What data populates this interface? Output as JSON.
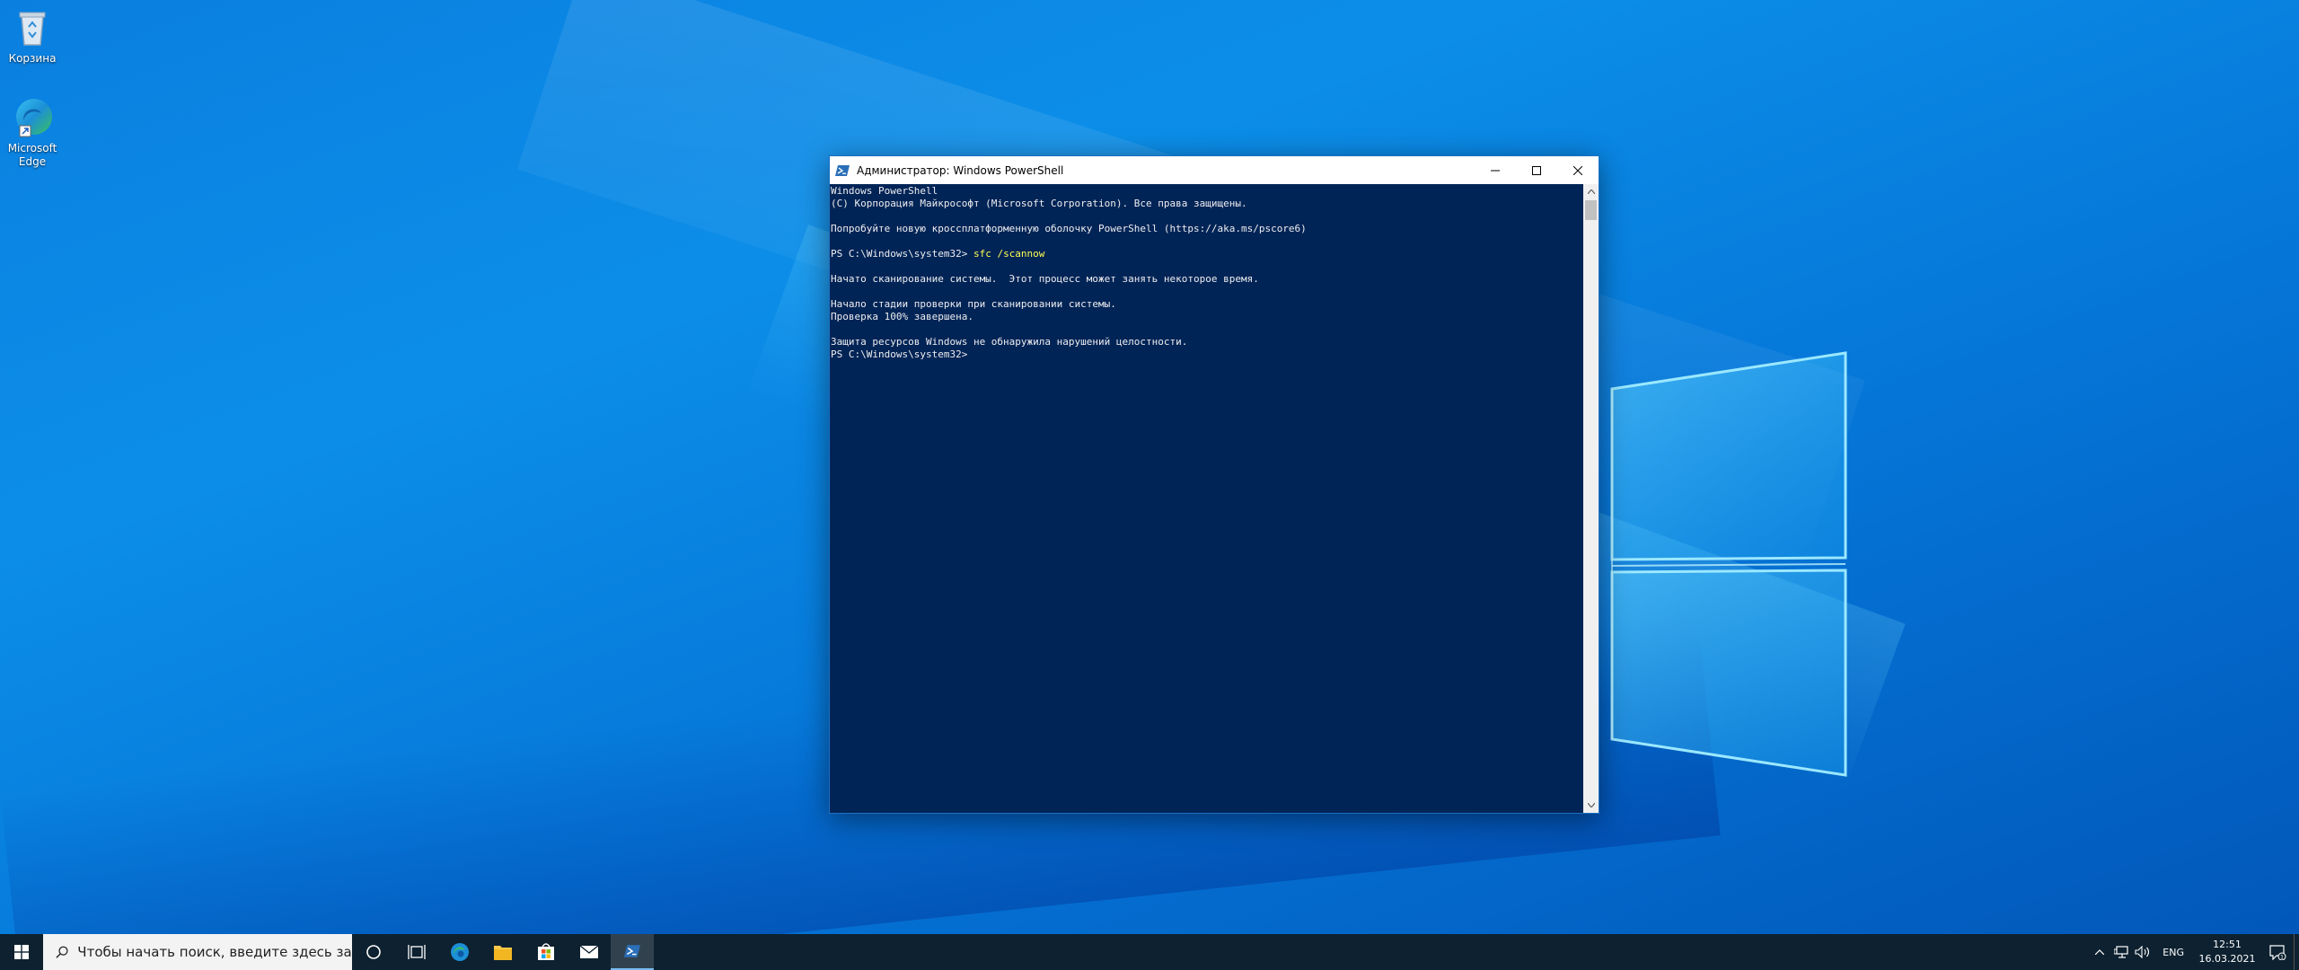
{
  "desktop": {
    "icons": [
      {
        "label": "Корзина",
        "icon": "recycle-bin-icon"
      },
      {
        "label": "Microsoft Edge",
        "icon": "edge-icon"
      }
    ]
  },
  "window": {
    "title": "Администратор: Windows PowerShell",
    "app_icon": "powershell-icon",
    "buttons": [
      "minimize",
      "maximize",
      "close"
    ]
  },
  "console": {
    "lines": [
      {
        "text": "Windows PowerShell"
      },
      {
        "text": "(C) Корпорация Майкрософт (Microsoft Corporation). Все права защищены."
      },
      {
        "text": ""
      },
      {
        "text": "Попробуйте новую кроссплатформенную оболочку PowerShell (https://aka.ms/pscore6)"
      },
      {
        "text": ""
      },
      {
        "prompt": "PS C:\\Windows\\system32> ",
        "command": "sfc /scannow"
      },
      {
        "text": ""
      },
      {
        "text": "Начато сканирование системы.  Этот процесс может занять некоторое время."
      },
      {
        "text": ""
      },
      {
        "text": "Начало стадии проверки при сканировании системы."
      },
      {
        "text": "Проверка 100% завершена."
      },
      {
        "text": ""
      },
      {
        "text": "Защита ресурсов Windows не обнаружила нарушений целостности."
      },
      {
        "text": "PS C:\\Windows\\system32>"
      }
    ]
  },
  "taskbar": {
    "search_placeholder": "Чтобы начать поиск, введите здесь запрос",
    "apps": [
      "cortana",
      "task-view",
      "edge",
      "file-explorer",
      "store",
      "mail",
      "powershell"
    ],
    "active_app": "powershell",
    "language": "ENG",
    "time": "12:51",
    "date": "16.03.2021",
    "notification_count": "1"
  },
  "colors": {
    "console_bg": "#012456",
    "console_fg": "#eeedf0",
    "command": "#fefe52",
    "taskbar": "#0d2130"
  }
}
